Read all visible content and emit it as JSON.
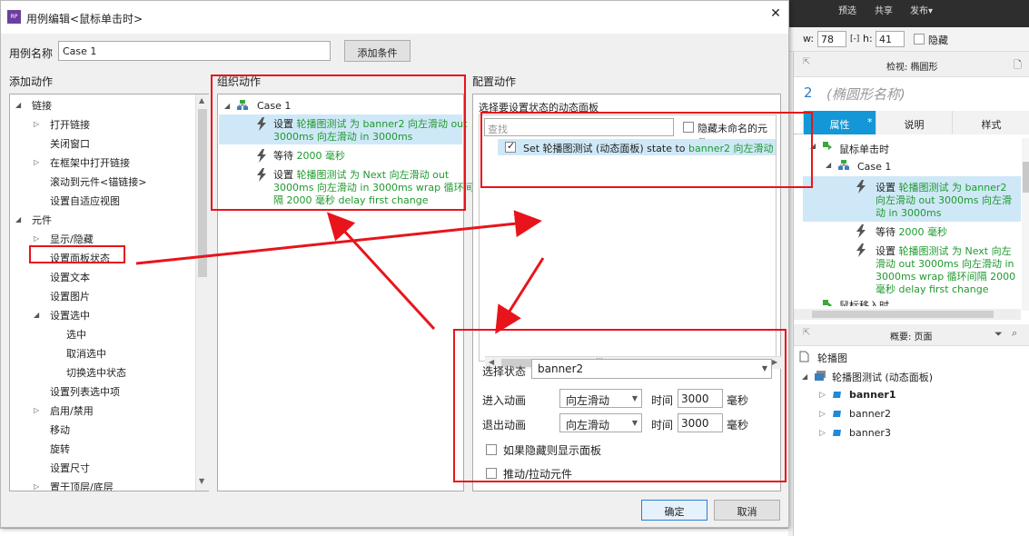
{
  "dialog": {
    "title": "用例编辑<鼠标单击时>",
    "close_label": "✕",
    "usecase_label": "用例名称",
    "usecase_value": "Case 1",
    "add_condition": "添加条件",
    "ok": "确定",
    "cancel": "取消"
  },
  "sections": {
    "add_action": "添加动作",
    "organize": "组织动作",
    "configure": "配置动作"
  },
  "actions_tree": [
    {
      "label": "链接",
      "level": 0,
      "expander": "open"
    },
    {
      "label": "打开链接",
      "level": 1,
      "expander": "closed"
    },
    {
      "label": "关闭窗口",
      "level": 1,
      "expander": "none"
    },
    {
      "label": "在框架中打开链接",
      "level": 1,
      "expander": "closed"
    },
    {
      "label": "滚动到元件<锚链接>",
      "level": 1,
      "expander": "none"
    },
    {
      "label": "设置自适应视图",
      "level": 1,
      "expander": "none"
    },
    {
      "label": "元件",
      "level": 0,
      "expander": "open"
    },
    {
      "label": "显示/隐藏",
      "level": 1,
      "expander": "closed"
    },
    {
      "label": "设置面板状态",
      "level": 1,
      "expander": "none"
    },
    {
      "label": "设置文本",
      "level": 1,
      "expander": "none"
    },
    {
      "label": "设置图片",
      "level": 1,
      "expander": "none"
    },
    {
      "label": "设置选中",
      "level": 1,
      "expander": "open"
    },
    {
      "label": "选中",
      "level": 2,
      "expander": "none"
    },
    {
      "label": "取消选中",
      "level": 2,
      "expander": "none"
    },
    {
      "label": "切换选中状态",
      "level": 2,
      "expander": "none"
    },
    {
      "label": "设置列表选中项",
      "level": 1,
      "expander": "none"
    },
    {
      "label": "启用/禁用",
      "level": 1,
      "expander": "closed"
    },
    {
      "label": "移动",
      "level": 1,
      "expander": "none"
    },
    {
      "label": "旋转",
      "level": 1,
      "expander": "none"
    },
    {
      "label": "设置尺寸",
      "level": 1,
      "expander": "none"
    },
    {
      "label": "置于顶层/底层",
      "level": 1,
      "expander": "closed"
    }
  ],
  "organize": {
    "case_label": "Case 1",
    "items": [
      {
        "lines": [
          [
            [
              "设置 ",
              ""
            ],
            [
              "轮播图测试 为 banner2 向左滑动 out",
              "g"
            ]
          ],
          [
            [
              "3000ms 向左滑动 in 3000ms",
              "g"
            ]
          ]
        ],
        "selected": true
      },
      {
        "lines": [
          [
            [
              "等待 ",
              ""
            ],
            [
              "2000 毫秒",
              "g"
            ]
          ]
        ],
        "selected": false
      },
      {
        "lines": [
          [
            [
              "设置 ",
              ""
            ],
            [
              "轮播图测试 为 Next 向左滑动 out",
              "g"
            ]
          ],
          [
            [
              "3000ms 向左滑动 in 3000ms wrap 循环间",
              "g"
            ]
          ],
          [
            [
              "隔 2000 毫秒 delay first change",
              "g"
            ]
          ]
        ],
        "selected": false
      }
    ]
  },
  "configure": {
    "select_panel_title": "选择要设置状态的动态面板",
    "search_placeholder": "查找",
    "hide_unnamed": "隐藏未命名的元件",
    "panel_row_prefix": "Set 轮播图测试 (动态面板) state to ",
    "panel_row_value": "banner2 向左滑动 out 3",
    "select_state_label": "选择状态",
    "select_state_value": "banner2",
    "enter_anim_label": "进入动画",
    "enter_anim_value": "向左滑动",
    "exit_anim_label": "退出动画",
    "exit_anim_value": "向左滑动",
    "time_label": "时间",
    "enter_time": "3000",
    "exit_time": "3000",
    "ms_label": "毫秒",
    "show_if_hidden": "如果隐藏则显示面板",
    "push_pull": "推动/拉动元件"
  },
  "editor": {
    "top_menu": [
      "预选",
      "共享",
      "发布▾"
    ],
    "w_label": "w:",
    "w_value": "78",
    "h_label": "h:",
    "h_value": "41",
    "hidden_label": "隐藏",
    "inspector_title": "检视: 椭圆形",
    "shape_number": "2",
    "shape_name": "(椭圆形名称)",
    "tabs": [
      "属性",
      "说明",
      "样式"
    ],
    "tab_star": "*",
    "event_label": "鼠标单击时",
    "case_label": "Case 1",
    "item1": [
      [
        "设置 ",
        ""
      ],
      [
        "轮播图测试 为 banner2",
        "g"
      ]
    ],
    "item1b": [
      [
        "向左滑动 out 3000ms 向左滑",
        "g"
      ]
    ],
    "item1c": [
      [
        "动 in 3000ms",
        "g"
      ]
    ],
    "item2": [
      [
        "等待 ",
        ""
      ],
      [
        "2000 毫秒",
        "g"
      ]
    ],
    "item3": [
      [
        "设置 ",
        ""
      ],
      [
        "轮播图测试 为 Next 向左",
        "g"
      ]
    ],
    "item3b": [
      [
        "滑动 out 3000ms 向左滑动 in",
        "g"
      ]
    ],
    "item3c": [
      [
        "3000ms wrap 循环间隔 2000",
        "g"
      ]
    ],
    "item3d": [
      [
        "毫秒 delay first change",
        "g"
      ]
    ],
    "cut_label": "鼠标移入时",
    "outline_title": "概要: 页面",
    "outline": [
      {
        "label": "轮播图",
        "level": 0,
        "bold": false
      },
      {
        "label": "轮播图测试 (动态面板)",
        "level": 1,
        "bold": false
      },
      {
        "label": "banner1",
        "level": 2,
        "bold": true
      },
      {
        "label": "banner2",
        "level": 2,
        "bold": false
      },
      {
        "label": "banner3",
        "level": 2,
        "bold": false
      }
    ]
  },
  "colors": {
    "accent": "#1497d6",
    "green_text": "#1e9a2e",
    "highlight_red": "#e8141b",
    "selection": "#cfe8f7"
  }
}
